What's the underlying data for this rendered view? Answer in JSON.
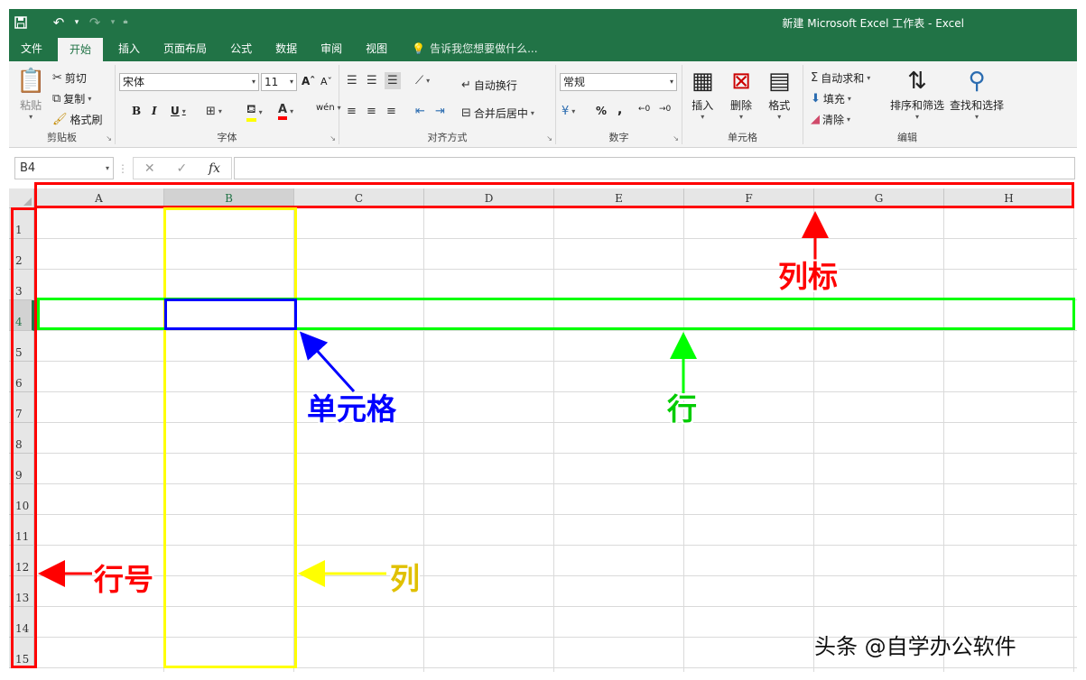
{
  "titlebar": {
    "title": "新建 Microsoft Excel 工作表 - Excel",
    "qat": {
      "save": "save-icon",
      "undo": "undo-icon",
      "redo": "redo-icon",
      "customize": "customize-qat-icon"
    }
  },
  "tabs": [
    {
      "label": "文件"
    },
    {
      "label": "开始",
      "active": true
    },
    {
      "label": "插入"
    },
    {
      "label": "页面布局"
    },
    {
      "label": "公式"
    },
    {
      "label": "数据"
    },
    {
      "label": "审阅"
    },
    {
      "label": "视图"
    }
  ],
  "tellme": {
    "placeholder": "告诉我您想要做什么..."
  },
  "ribbon": {
    "clipboard": {
      "label": "剪贴板",
      "paste": "粘贴",
      "cut": "剪切",
      "copy": "复制",
      "format_painter": "格式刷"
    },
    "font": {
      "label": "字体",
      "font_name": "宋体",
      "font_size": "11",
      "bold": "B",
      "italic": "I",
      "underline": "U",
      "font_color_letter": "A",
      "phonetic": "wén"
    },
    "alignment": {
      "label": "对齐方式",
      "wrap_text": "自动换行",
      "merge_center": "合并后居中"
    },
    "number": {
      "label": "数字",
      "format": "常规",
      "percent": "%",
      "comma": ","
    },
    "cells": {
      "label": "单元格",
      "insert": "插入",
      "delete": "删除",
      "format": "格式"
    },
    "editing": {
      "label": "编辑",
      "autosum": "自动求和",
      "fill": "填充",
      "clear": "清除",
      "sort_filter": "排序和筛选",
      "find_select": "查找和选择"
    }
  },
  "formula_bar": {
    "name_box": "B4",
    "cancel": "✕",
    "enter": "✓",
    "fx": "fx",
    "content": ""
  },
  "grid": {
    "columns": [
      "A",
      "B",
      "C",
      "D",
      "E",
      "F",
      "G",
      "H"
    ],
    "rows": [
      "1",
      "2",
      "3",
      "4",
      "5",
      "6",
      "7",
      "8",
      "9",
      "10",
      "11",
      "12",
      "13",
      "14",
      "15"
    ],
    "selected_cell": "B4"
  },
  "annotations": {
    "column_headers": "列标",
    "cell": "单元格",
    "row": "行",
    "row_numbers": "行号",
    "column": "列",
    "colors": {
      "red": "#ff0000",
      "blue": "#0000ff",
      "green": "#00ff00",
      "yellow": "#ffff00"
    }
  },
  "watermark": "头条 @自学办公软件",
  "colors": {
    "excel_green": "#217346",
    "ribbon_bg": "#f3f3f3",
    "header_bg": "#e6e6e6"
  }
}
